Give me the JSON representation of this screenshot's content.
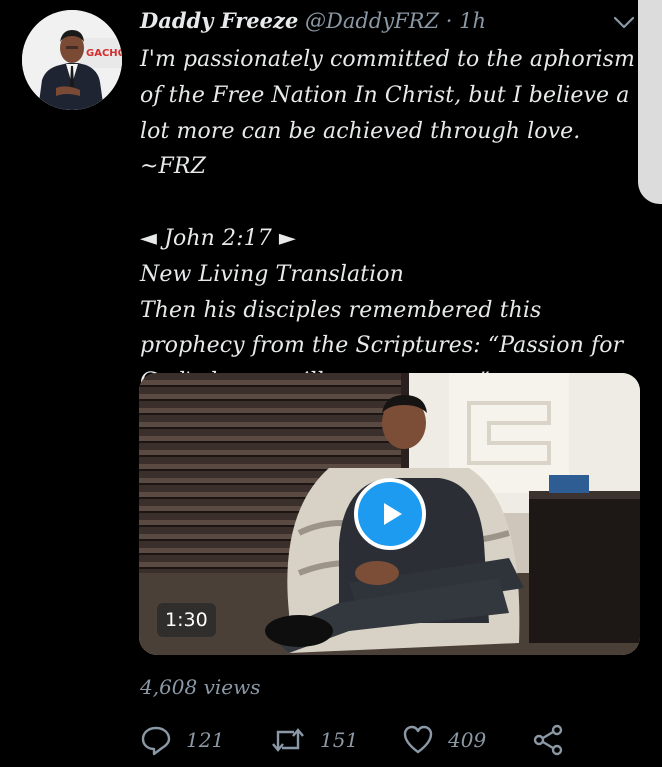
{
  "tweet": {
    "display_name": "Daddy Freeze",
    "handle": "@DaddyFRZ",
    "separator": "·",
    "time": "1h",
    "body": "I'm passionately committed to the aphorism of the Free Nation In Christ, but I believe a lot more can be achieved through love. ~FRZ\n\n◄ John 2:17 ►\nNew Living Translation\nThen his disciples remembered this prophecy from the Scriptures: “Passion for God's house will consume me.”",
    "avatar_sign_text": "GACHO",
    "media": {
      "duration": "1:30"
    },
    "views": "4,608 views"
  },
  "actions": {
    "reply": {
      "count": "121",
      "icon": "reply-icon"
    },
    "retweet": {
      "count": "151",
      "icon": "retweet-icon"
    },
    "like": {
      "count": "409",
      "icon": "like-icon"
    },
    "share": {
      "icon": "share-icon"
    }
  },
  "colors": {
    "background": "#000000",
    "text": "#e7e9ea",
    "muted": "#8b98a5",
    "accent": "#1d9bf0"
  }
}
